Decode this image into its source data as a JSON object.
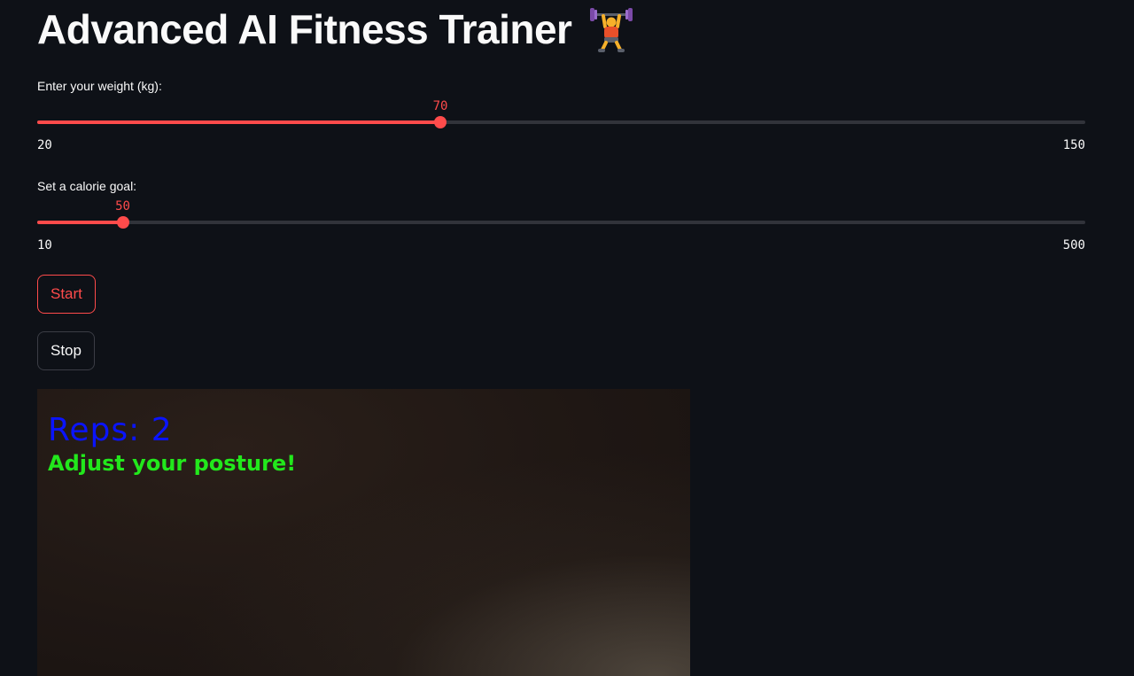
{
  "page": {
    "title": "Advanced AI Fitness Trainer",
    "title_icon": "weightlifter-icon"
  },
  "weight_slider": {
    "label": "Enter your weight (kg):",
    "value": 70,
    "min": 20,
    "max": 150,
    "value_text": "70",
    "min_text": "20",
    "max_text": "150"
  },
  "calorie_slider": {
    "label": "Set a calorie goal:",
    "value": 50,
    "min": 10,
    "max": 500,
    "value_text": "50",
    "min_text": "10",
    "max_text": "500"
  },
  "buttons": {
    "start_label": "Start",
    "stop_label": "Stop"
  },
  "video": {
    "reps_text": "Reps: 2",
    "feedback_text": "Adjust your posture!"
  },
  "colors": {
    "background": "#0e1117",
    "accent": "#ff4b4b",
    "text": "#fafafa",
    "reps_overlay": "#0a14ff",
    "feedback_overlay": "#22e81c"
  }
}
